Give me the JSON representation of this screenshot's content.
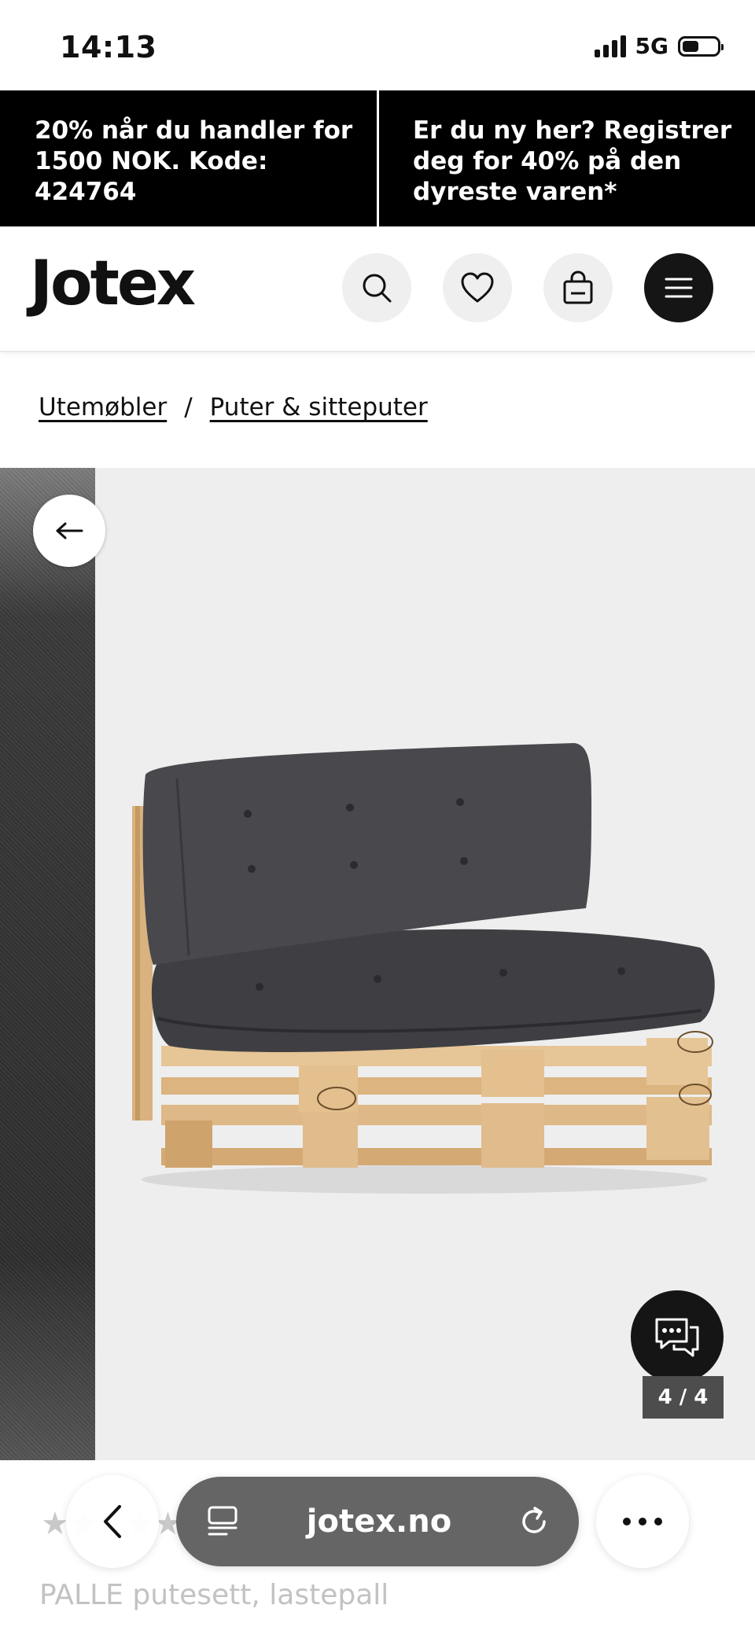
{
  "status_bar": {
    "time": "14:13",
    "network": "5G"
  },
  "promo": [
    {
      "text": "20% når du handler for 1500 NOK. Kode: 424764"
    },
    {
      "text": "Er du ny her? Registrer deg for 40% på den dyreste varen*"
    }
  ],
  "header": {
    "logo": "Jotex",
    "icons": [
      "search-icon",
      "heart-icon",
      "bag-icon",
      "menu-icon"
    ]
  },
  "breadcrumb": {
    "items": [
      "Utemøbler",
      "Puter & sitteputer"
    ],
    "separator": "/"
  },
  "gallery": {
    "counter": "4 / 4"
  },
  "product": {
    "name": "PALLE putesett, lastepall",
    "stars": "★★★★★"
  },
  "browser": {
    "url": "jotex.no"
  },
  "colors": {
    "promo_bg": "#000000",
    "dark_button": "#151515",
    "counter_bg": "#4d4d4d"
  }
}
